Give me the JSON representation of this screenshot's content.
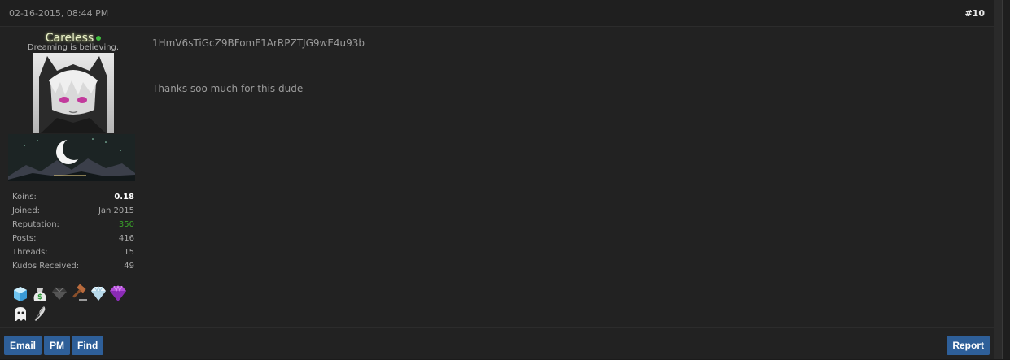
{
  "post": {
    "date": "02-16-2015, 08:44 PM",
    "number": "#10"
  },
  "author": {
    "username": "Careless",
    "title": "Dreaming is believing.",
    "online": true,
    "stats": [
      {
        "label": "Koins:",
        "value": "0.18"
      },
      {
        "label": "Joined:",
        "value": "Jan 2015"
      },
      {
        "label": "Reputation:",
        "value": "350"
      },
      {
        "label": "Posts:",
        "value": "416"
      },
      {
        "label": "Threads:",
        "value": "15"
      },
      {
        "label": "Kudos Received:",
        "value": "49"
      }
    ],
    "awards": [
      "ice-cube-icon",
      "money-bag-icon",
      "dark-gem-icon",
      "gavel-icon",
      "white-diamond-icon",
      "purple-diamond-icon",
      "ghost-icon",
      "feather-icon"
    ]
  },
  "message": {
    "lines": [
      "1HmV6sTiGcZ9BFomF1ArRPZTJG9wE4u93b",
      "Thanks soo much for this dude"
    ]
  },
  "footer": {
    "email": "Email",
    "pm": "PM",
    "find": "Find",
    "report": "Report"
  },
  "colors": {
    "background": "#222222",
    "button": "#2e5f99",
    "reputation": "#3aa32a",
    "online": "#3fbf3f"
  }
}
